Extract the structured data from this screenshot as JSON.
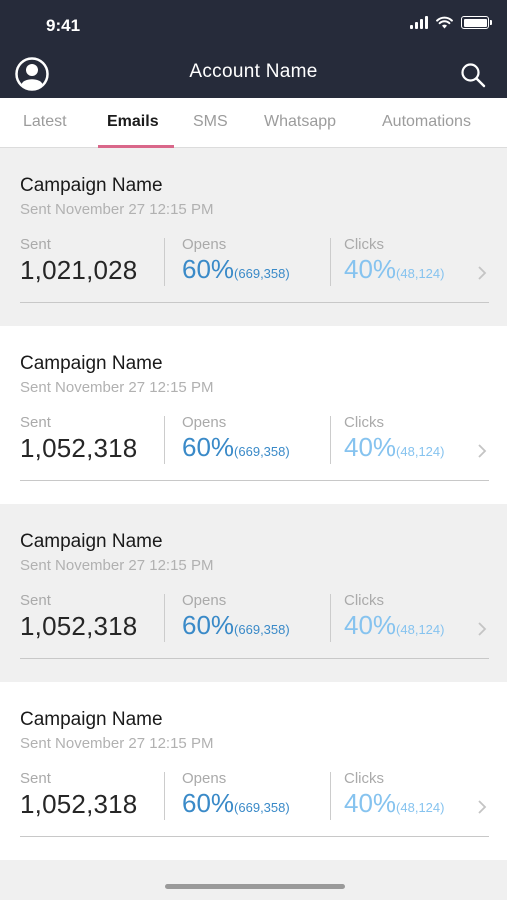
{
  "status_bar": {
    "time": "9:41"
  },
  "header": {
    "title": "Account Name"
  },
  "tabs": [
    {
      "label": "Latest"
    },
    {
      "label": "Emails",
      "active": true
    },
    {
      "label": "SMS"
    },
    {
      "label": "Whatsapp"
    },
    {
      "label": "Automations"
    }
  ],
  "campaigns": [
    {
      "name": "Campaign Name",
      "sent_date": "Sent November 27 12:15 PM",
      "sent_label": "Sent",
      "sent": "1,021,028",
      "opens_label": "Opens",
      "opens_pct": "60%",
      "opens_count": "(669,358)",
      "clicks_label": "Clicks",
      "clicks_pct": "40%",
      "clicks_count": "(48,124)"
    },
    {
      "name": "Campaign Name",
      "sent_date": "Sent November 27 12:15 PM",
      "sent_label": "Sent",
      "sent": "1,052,318",
      "opens_label": "Opens",
      "opens_pct": "60%",
      "opens_count": "(669,358)",
      "clicks_label": "Clicks",
      "clicks_pct": "40%",
      "clicks_count": "(48,124)"
    },
    {
      "name": "Campaign Name",
      "sent_date": "Sent November 27 12:15 PM",
      "sent_label": "Sent",
      "sent": "1,052,318",
      "opens_label": "Opens",
      "opens_pct": "60%",
      "opens_count": "(669,358)",
      "clicks_label": "Clicks",
      "clicks_pct": "40%",
      "clicks_count": "(48,124)"
    },
    {
      "name": "Campaign Name",
      "sent_date": "Sent November 27 12:15 PM",
      "sent_label": "Sent",
      "sent": "1,052,318",
      "opens_label": "Opens",
      "opens_pct": "60%",
      "opens_count": "(669,358)",
      "clicks_label": "Clicks",
      "clicks_pct": "40%",
      "clicks_count": "(48,124)"
    }
  ],
  "icons": {
    "avatar": "user-avatar-icon",
    "search": "search-icon",
    "chevron": "chevron-right-icon"
  },
  "colors": {
    "header_bg": "#262b3a",
    "active_tab_underline": "#d9678a",
    "opens_accent": "#3a8ac8",
    "clicks_accent": "#86c3ef"
  }
}
